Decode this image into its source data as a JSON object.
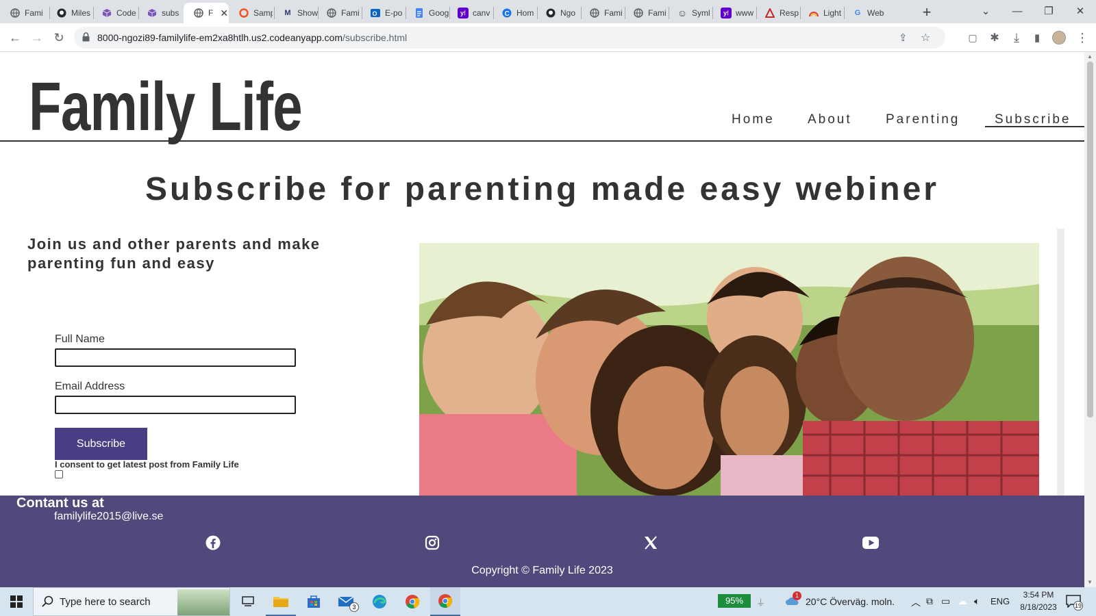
{
  "browser": {
    "tabs": [
      {
        "label": "Fami",
        "icon": "globe-icon"
      },
      {
        "label": "Miles",
        "icon": "github-icon"
      },
      {
        "label": "Code",
        "icon": "cube-icon"
      },
      {
        "label": "subs",
        "icon": "cube-icon"
      },
      {
        "label": "F",
        "icon": "globe-icon",
        "active": true
      },
      {
        "label": "Samp",
        "icon": "circle-icon"
      },
      {
        "label": "Show",
        "icon": "mask-icon"
      },
      {
        "label": "Fami",
        "icon": "globe-icon"
      },
      {
        "label": "E-po",
        "icon": "outlook-icon"
      },
      {
        "label": "Goog",
        "icon": "google-docs-icon"
      },
      {
        "label": "canv",
        "icon": "yahoo-icon"
      },
      {
        "label": "Hom",
        "icon": "c-logo-icon"
      },
      {
        "label": "Ngo",
        "icon": "github-icon"
      },
      {
        "label": "Fami",
        "icon": "globe-icon"
      },
      {
        "label": "Fami",
        "icon": "globe-icon"
      },
      {
        "label": "Syml",
        "icon": "smiley-icon"
      },
      {
        "label": "www",
        "icon": "yahoo-icon"
      },
      {
        "label": "Resp",
        "icon": "triangle-icon"
      },
      {
        "label": "Light",
        "icon": "rainbow-icon"
      },
      {
        "label": "Web",
        "icon": "google-icon"
      }
    ],
    "url_host": "8000-ngozi89-familylife-em2xa8htlh.us2.codeanyapp.com",
    "url_path": "/subscribe.html"
  },
  "site": {
    "logo": "Family Life",
    "nav": [
      "Home",
      "About",
      "Parenting",
      "Subscribe"
    ],
    "active_nav": "Subscribe",
    "heading": "Subscribe for parenting made easy webiner",
    "subheading": "Join us and other parents and make parenting fun and easy",
    "form": {
      "full_name_label": "Full Name",
      "full_name_value": "",
      "email_label": "Email Address",
      "email_value": "",
      "submit_label": "Subscribe",
      "consent_label": "I consent to get latest post from Family Life",
      "consent_checked": false
    },
    "footer": {
      "contact_title": "Contant us at",
      "email": "familylife2015@live.se",
      "social": [
        "facebook-icon",
        "instagram-icon",
        "x-icon",
        "youtube-icon"
      ],
      "copyright": "Copyright © Family Life 2023"
    }
  },
  "taskbar": {
    "search_placeholder": "Type here to search",
    "mail_badge": "3",
    "battery": "95%",
    "weather": "20°C  Överväg. moln.",
    "weather_badge": "1",
    "language": "ENG",
    "time": "3:54 PM",
    "date": "8/18/2023",
    "notifications": "19"
  },
  "colors": {
    "accent": "#4a3d84",
    "footer": "#504a7c",
    "text": "#333333"
  }
}
